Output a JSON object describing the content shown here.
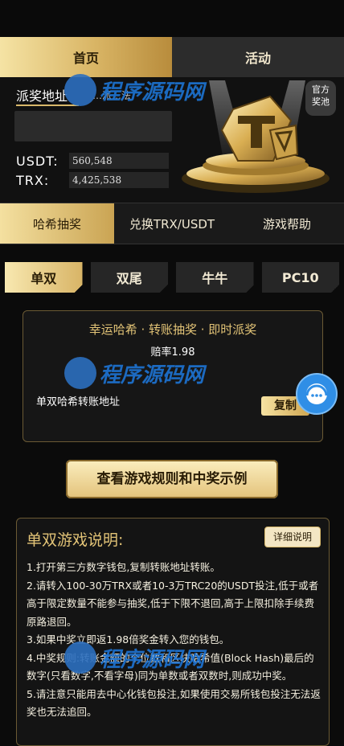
{
  "main_tabs": {
    "home": "首页",
    "activity": "活动"
  },
  "prize": {
    "address_title": "派奖地址",
    "address_sub": "…派…法",
    "usdt_label": "USDT:",
    "usdt_value": "560,548",
    "trx_label": "TRX:",
    "trx_value": "4,425,538",
    "official_line1": "官方",
    "official_line2": "奖池"
  },
  "sub_tabs": [
    "哈希抽奖",
    "兑换TRX/USDT",
    "游戏帮助"
  ],
  "game_tabs": [
    "单双",
    "双尾",
    "牛牛",
    "PC10"
  ],
  "card": {
    "title": "幸运哈希 · 转账抽奖 · 即时派奖",
    "rate": "赔率1.98",
    "address_label": "单双哈希转账地址",
    "copy": "复制"
  },
  "rules_button": "查看游戏规则和中奖示例",
  "description": {
    "title": "单双游戏说明:",
    "detail": "详细说明",
    "items": [
      "1.打开第三方数字钱包,复制转账地址转账。",
      "2.请转入100-30万TRX或者10-3万TRC20的USDT投注,低于或者高于限定数量不能参与抽奖,低于下限不退回,高于上限扣除手续费原路退回。",
      "3.如果中奖立即返1.98倍奖金转入您的钱包。",
      "4.中奖规则:转账金额的个位数和区块哈希值(Block Hash)最后的数字(只看数字,不看字母)同为单数或者双数时,则成功中奖。",
      "5.请注意只能用去中心化钱包投注,如果使用交易所钱包投注无法返奖也无法追回。"
    ]
  },
  "watermark": "程序源码网",
  "colors": {
    "gold": "#d8b86a",
    "gold_light": "#f5e3a4",
    "bg": "#0b0b0b",
    "accent_blue": "#2f8ee6"
  }
}
